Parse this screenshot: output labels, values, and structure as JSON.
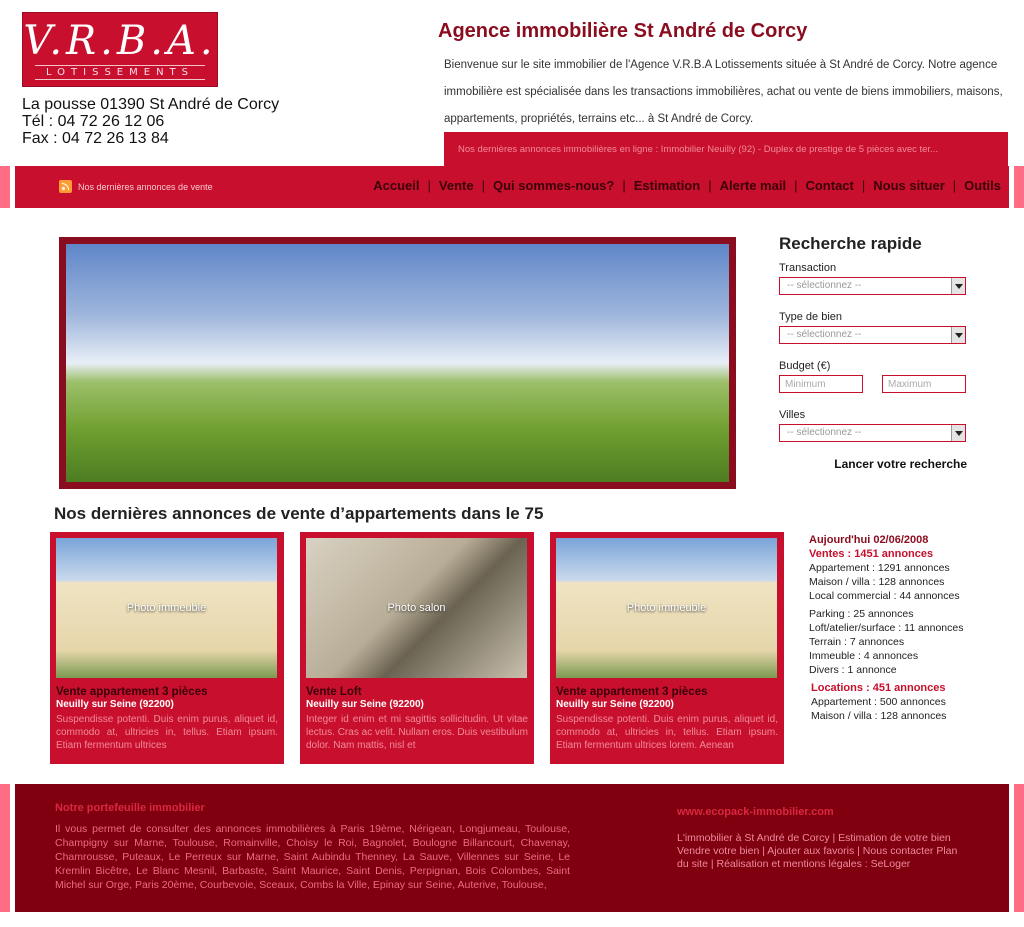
{
  "header": {
    "logo_main": "V.R.B.A.",
    "logo_sub": "LOTISSEMENTS",
    "address": "La pousse 01390 St André de Corcy",
    "phone": "Tél : 04 72  26 12 06",
    "fax": "Fax : 04 72 26 13 84",
    "site_title": "Agence immobilière St André de Corcy",
    "intro": "Bienvenue sur le site immobilier de l'Agence V.R.B.A Lotissements située à St André de Corcy. Notre agence immobilière est spécialisée dans les transactions immobilières, achat ou vente de biens immobiliers, maisons, appartements, propriétés, terrains etc... à St André de Corcy.",
    "ticker": "Nos dernières annonces immobilières en ligne : Immobilier Neuilly (92) - Duplex de prestige de 5 pièces avec ter..."
  },
  "nav": {
    "rss_label": "Nos dernières annonces de vente",
    "items": [
      "Accueil",
      "Vente",
      "Qui sommes-nous?",
      "Estimation",
      "Alerte mail",
      "Contact",
      "Nous situer",
      "Outils"
    ]
  },
  "hero": {
    "alt": "Paysage campagne"
  },
  "quick_search": {
    "title": "Recherche rapide",
    "transaction_label": "Transaction",
    "transaction_value": "-- sélectionnez --",
    "type_label": "Type de bien",
    "type_value": "-- sélectionnez --",
    "budget_label": "Budget (€)",
    "min_placeholder": "Minimum",
    "max_placeholder": "Maximum",
    "cities_label": "Villes",
    "cities_value": "-- sélectionnez --",
    "submit": "Lancer votre recherche"
  },
  "listings": {
    "title": "Nos dernières annonces  de vente d’appartements dans le 75",
    "cards": [
      {
        "title": "Vente appartement 3 pièces",
        "location": "Neuilly sur Seine (92200)",
        "description": "Suspendisse potenti. Duis enim purus, aliquet id, commodo at, ultricies in, tellus. Etiam ipsum. Etiam fermentum ultrices",
        "photo": "Photo immeuble"
      },
      {
        "title": "Vente Loft",
        "location": "Neuilly sur Seine (92200)",
        "description": "Integer id enim et mi sagittis sollicitudin. Ut vitae lectus. Cras ac velit. Nullam eros. Duis vestibulum dolor. Nam mattis, nisl et",
        "photo": "Photo salon"
      },
      {
        "title": "Vente appartement 3 pièces",
        "location": "Neuilly sur Seine (92200)",
        "description": "Suspendisse potenti. Duis enim purus, aliquet id, commodo at, ultricies in, tellus. Etiam ipsum. Etiam fermentum ultrices lorem. Aenean",
        "photo": "Photo immeuble"
      }
    ]
  },
  "stats": {
    "date": "Aujourd'hui 02/06/2008",
    "sales_head": "Ventes : 1451 annonces",
    "sales": [
      "Appartement : 1291 annonces",
      "Maison / villa : 128 annonces",
      "Local commercial : 44 annonces"
    ],
    "sales2": [
      "Parking :  25 annonces",
      "Loft/atelier/surface : 11 annonces",
      "Terrain : 7 annonces",
      "Immeuble :  4 annonces",
      "Divers : 1 annonce"
    ],
    "rent_head": "Locations : 451 annonces",
    "rent": [
      "Appartement : 500 annonces",
      "Maison / villa : 128 annonces"
    ]
  },
  "footer": {
    "left_title": "Notre portefeuille immobilier",
    "left_text": "Il vous permet de consulter des annonces immobilières à Paris 19ème, Nérigean, Longjumeau, Toulouse, Champigny sur Marne, Toulouse, Romainville, Choisy le Roi, Bagnolet, Boulogne Billancourt, Chavenay, Chamrousse, Puteaux, Le Perreux sur Marne, Saint Aubindu Thenney, La Sauve, Villennes sur Seine, Le Kremlin Bicêtre, Le Blanc Mesnil, Barbaste, Saint Maurice, Saint Denis, Perpignan, Bois Colombes, Saint Michel sur Orge, Paris 20ème, Courbevoie, Sceaux, Combs la Ville, Epinay sur Seine, Auterive, Toulouse,",
    "right_title": "www.ecopack-immobilier.com",
    "right_links": "L'immobilier à St André de Corcy | Estimation de votre bien Vendre votre bien  | Ajouter aux favoris |  Nous contacter Plan du site | Réalisation et mentions légales : SeLoger"
  },
  "colors": {
    "brand": "#c8102e",
    "dark": "#800010",
    "accent": "#ff6d85"
  }
}
